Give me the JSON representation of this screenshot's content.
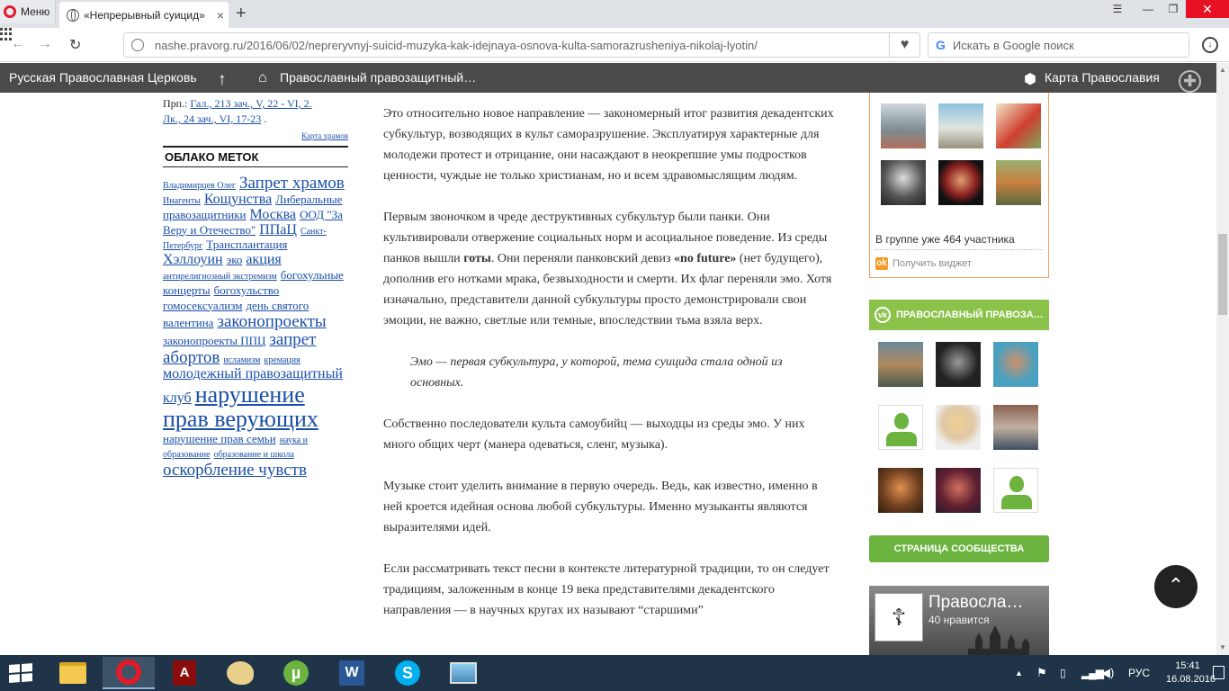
{
  "browser": {
    "menu_label": "Меню",
    "tab_title": "«Непрерывный суицид»",
    "tab_close": "×",
    "new_tab": "+",
    "url": "nashe.pravorg.ru/2016/06/02/nepreryvnyj-suicid-muzyka-kak-idejnaya-osnova-kulta-samorazrusheniya-nikolaj-lyotin/",
    "search_placeholder": "Искать в Google поиск",
    "google_letter": "G",
    "window": {
      "minimize": "—",
      "restore": "❐",
      "close": "✕",
      "tabmenu": "☰"
    }
  },
  "sitebar": {
    "rpc": "Русская Православная Церковь",
    "up": "↑",
    "home_icon": "⌂",
    "pp": "Православный правозащитный…",
    "map_icon": "⬢",
    "map": "Карта Православия",
    "cross": "✚"
  },
  "left": {
    "readings_prefix": "Прп.: ",
    "readings_link1": "Гал., 213 зач., V, 22 - VI, 2.",
    "readings_link2": "Лк., 24 зач., VI, 17-23",
    "readings_suffix": " .",
    "map_link": "Карта храмов",
    "cloud_title": "ОБЛАКО МЕТОК",
    "tags": [
      {
        "text": "Владимирцев Олег",
        "size": 1
      },
      {
        "text": "Запрет храмов",
        "size": 4
      },
      {
        "text": "Инагенты",
        "size": 1
      },
      {
        "text": "Кощунства",
        "size": 3
      },
      {
        "text": "Либеральные правозащитники",
        "size": 2
      },
      {
        "text": "Москва",
        "size": 3
      },
      {
        "text": "ООД \"За Веру и Отечество\"",
        "size": 2
      },
      {
        "text": "ППаЦ",
        "size": 3
      },
      {
        "text": "Санкт-Петербург",
        "size": 1
      },
      {
        "text": "Трансплантация",
        "size": 2
      },
      {
        "text": "Хэллоуин",
        "size": 3
      },
      {
        "text": "эко",
        "size": 2
      },
      {
        "text": "акция",
        "size": 3
      },
      {
        "text": "антирелигиозный экстремизм",
        "size": 1
      },
      {
        "text": "богохульные концерты",
        "size": 2
      },
      {
        "text": "богохульство",
        "size": 2
      },
      {
        "text": "гомосексуализм",
        "size": 2
      },
      {
        "text": "день святого валентина",
        "size": 2
      },
      {
        "text": "законопроекты",
        "size": 4
      },
      {
        "text": "законопроекты ППЦ",
        "size": 2
      },
      {
        "text": "запрет абортов",
        "size": 4
      },
      {
        "text": "исламизм",
        "size": 1
      },
      {
        "text": "кремация",
        "size": 1
      },
      {
        "text": "молодежный правозащитный клуб",
        "size": 3
      },
      {
        "text": "нарушение прав верующих",
        "size": 6
      },
      {
        "text": "нарушение прав семьи",
        "size": 2
      },
      {
        "text": "наука и образование",
        "size": 1
      },
      {
        "text": "образование и школа",
        "size": 1
      },
      {
        "text": "оскорбление чувств",
        "size": 4
      }
    ]
  },
  "article": {
    "p1": "Это относительно новое направление — закономерный итог развития декадентских субкультур, возводящих в культ саморазрушение. Эксплуатируя характерные для молодежи протест и отрицание, они насаждают в неокрепшие умы подростков ценности, чуждые не только христианам, но и всем здравомыслящим людям.",
    "p2_a": "Первым звоночком в чреде деструктивных субкультур были панки. Они культивировали отвержение социальных норм и асоциальное поведение. Из среды панков вышли ",
    "p2_b": "готы",
    "p2_c": ". Они переняли панковский девиз ",
    "p2_d": "«no future»",
    "p2_e": " (нет будущего), дополнив его нотками мрака, безвыходности и смерти. Их флаг переняли эмо. Хотя изначально, представители данной субкультуры просто демонстрировали свои эмоции, не важно, светлые или темные, впоследствии тьма взяла верх.",
    "quote": "Эмо — первая субкультура, у которой, тема суицида стала одной из основных.",
    "p3": "Собственно последователи культа самоубийц — выходцы из среды эмо. У них много общих черт (манера одеваться, сленг, музыка).",
    "p4": "Музыке стоит уделить внимание в первую очередь. Ведь, как известно, именно в ней кроется идейная основа любой субкультуры. Именно музыканты являются выразителями идей.",
    "p5": "Если рассматривать текст песни в контексте литературной традиции, то он следует традициям, заложенным в конце 19 века представителями декадентского направления — в научных кругах их называют “старшими”"
  },
  "right": {
    "ok_count": "В группе уже 464 участника",
    "ok_get_widget": "Получить виджет",
    "ok_icon": "ok",
    "group_title": "ПРАВОСЛАВНЫЙ ПРАВОЗА…",
    "community_button": "СТРАНИЦА СООБЩЕСТВА",
    "fb_name": "Правосла…",
    "fb_likes": "40 нравится"
  },
  "scroll": {
    "up": "▲",
    "down": "▼"
  },
  "totop": "⌃",
  "taskbar": {
    "pdf_glyph": "A",
    "utor_glyph": "µ",
    "word_glyph": "W",
    "skype_glyph": "S",
    "tray_arrow": "▲",
    "tray_flag": "⚑",
    "tray_batt": "▯",
    "tray_net": "▂▄▆",
    "tray_vol": "◀)",
    "lang": "РУС",
    "time": "15:41",
    "date": "16.08.2016"
  }
}
